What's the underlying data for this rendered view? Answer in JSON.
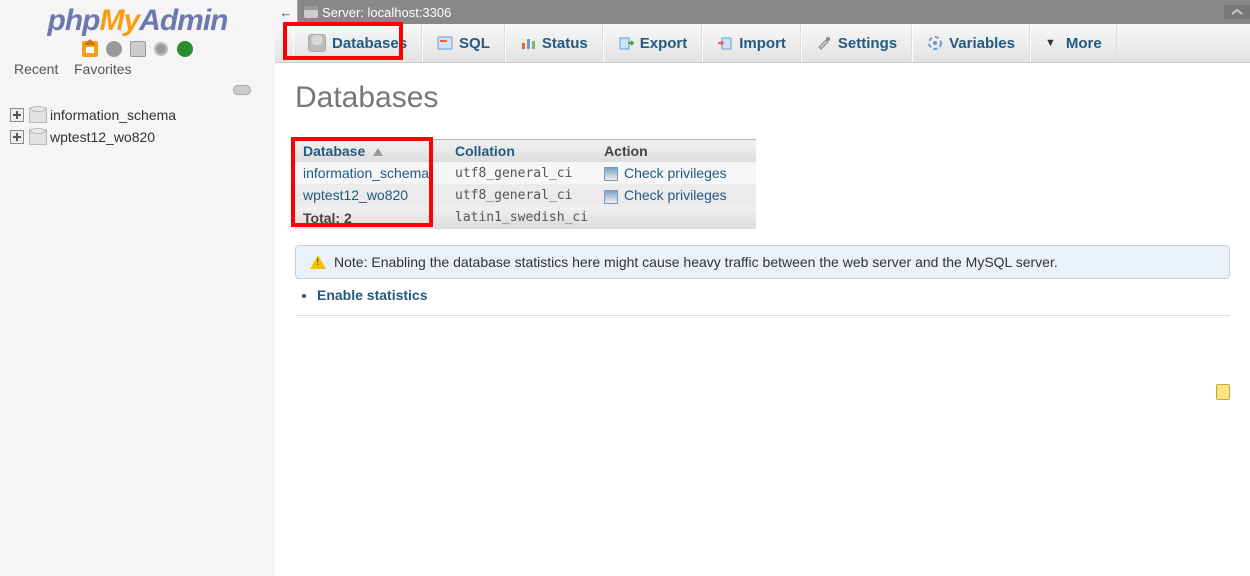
{
  "sidebar": {
    "tabs": {
      "recent": "Recent",
      "favorites": "Favorites"
    },
    "tree": [
      {
        "name": "information_schema"
      },
      {
        "name": "wptest12_wo820"
      }
    ]
  },
  "server": {
    "label": "Server: localhost:3306"
  },
  "top_tabs": {
    "databases": "Databases",
    "sql": "SQL",
    "status": "Status",
    "export": "Export",
    "import": "Import",
    "settings": "Settings",
    "variables": "Variables",
    "more": "More"
  },
  "main": {
    "heading": "Databases",
    "columns": {
      "database": "Database",
      "collation": "Collation",
      "action": "Action"
    },
    "rows": [
      {
        "db": "information_schema",
        "collation": "utf8_general_ci",
        "action": "Check privileges"
      },
      {
        "db": "wptest12_wo820",
        "collation": "utf8_general_ci",
        "action": "Check privileges"
      }
    ],
    "total_label": "Total: 2",
    "total_collation": "latin1_swedish_ci",
    "note": "Note: Enabling the database statistics here might cause heavy traffic between the web server and the MySQL server.",
    "enable_stats": "Enable statistics"
  }
}
